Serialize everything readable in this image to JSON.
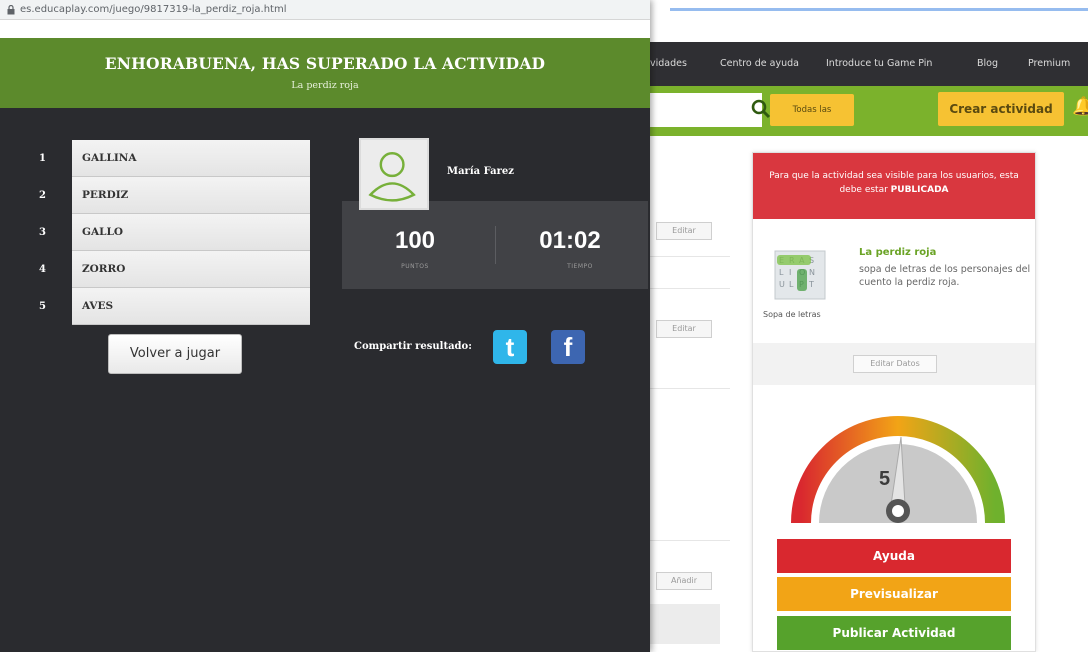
{
  "browser": {
    "url": "es.educaplay.com/juego/9817319-la_perdiz_roja.html"
  },
  "result": {
    "title": "ENHORABUENA, HAS SUPERADO LA ACTIVIDAD",
    "subtitle": "La perdiz roja"
  },
  "words": [
    {
      "num": "1",
      "word": "GALLINA"
    },
    {
      "num": "2",
      "word": "PERDIZ"
    },
    {
      "num": "3",
      "word": "GALLO"
    },
    {
      "num": "4",
      "word": "ZORRO"
    },
    {
      "num": "5",
      "word": "AVES"
    }
  ],
  "replay_label": "Volver a jugar",
  "user": {
    "name": "María Farez"
  },
  "score": {
    "points": "100",
    "points_label": "PUNTOS",
    "time": "01:02",
    "time_label": "TIEMPO"
  },
  "share": {
    "label": "Compartir resultado:",
    "twitter_glyph": "t",
    "facebook_glyph": "f"
  },
  "background": {
    "nav": [
      "vidades",
      "Centro de ayuda",
      "Introduce tu Game Pin",
      "Blog",
      "Premium"
    ],
    "all_activities": "Todas las actividades",
    "create_activity": "Crear actividad",
    "edit_label": "Editar",
    "add_label": "Añadir",
    "panel": {
      "alert_text": "Para que la actividad sea visible para los usuarios, esta debe estar ",
      "alert_bold": "PUBLICADA",
      "thumb_label": "Sopa de letras",
      "activity_title": "La perdiz roja",
      "activity_desc": "sopa de letras de los personajes del cuento la perdiz roja.",
      "edit_data": "Editar Datos",
      "gauge_value": "5",
      "help": "Ayuda",
      "preview": "Previsualizar",
      "publish": "Publicar Actividad"
    },
    "colors": {
      "green": "#7bb22c",
      "yellow": "#f6c233",
      "red": "#d9282f",
      "orange": "#f2a416"
    }
  }
}
